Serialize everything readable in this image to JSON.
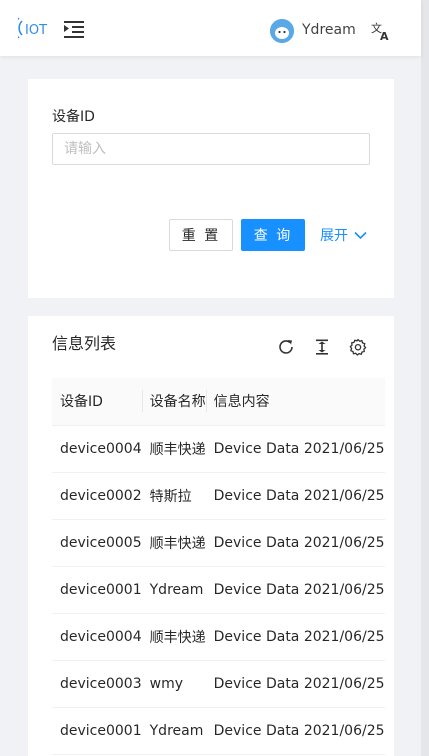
{
  "header": {
    "logo_text": "IOT",
    "username": "Ydream"
  },
  "search": {
    "label": "设备ID",
    "placeholder": "请输入",
    "value": "",
    "reset_label": "重 置",
    "query_label": "查 询",
    "expand_label": "展开"
  },
  "table": {
    "title": "信息列表",
    "columns": [
      "设备ID",
      "设备名称",
      "信息内容"
    ],
    "rows": [
      {
        "id": "device0004",
        "name": "顺丰快递",
        "content": "Device Data 2021/06/25"
      },
      {
        "id": "device0002",
        "name": "特斯拉",
        "content": "Device Data 2021/06/25"
      },
      {
        "id": "device0005",
        "name": "顺丰快递",
        "content": "Device Data 2021/06/25"
      },
      {
        "id": "device0001",
        "name": "Ydream",
        "content": "Device Data 2021/06/25"
      },
      {
        "id": "device0004",
        "name": "顺丰快递",
        "content": "Device Data 2021/06/25"
      },
      {
        "id": "device0003",
        "name": "wmy",
        "content": "Device Data 2021/06/25"
      },
      {
        "id": "device0001",
        "name": "Ydream",
        "content": "Device Data 2021/06/25"
      }
    ]
  },
  "colors": {
    "primary": "#1890ff",
    "background": "#f0f2f5",
    "avatar": "#5aa8e6"
  },
  "icons": [
    "iot-logo",
    "menu-fold-icon",
    "avatar",
    "translate-icon",
    "chevron-down-icon",
    "reload-icon",
    "column-height-icon",
    "setting-icon"
  ]
}
